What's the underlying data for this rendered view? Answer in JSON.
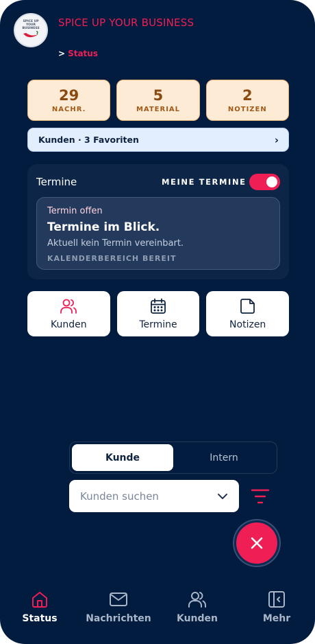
{
  "header": {
    "logo_text": "SPICE UP YOUR BUSINESS",
    "app_title": "SPICE UP YOUR BUSINESS",
    "breadcrumb_separator": ">",
    "breadcrumb_current": "Status"
  },
  "stats": [
    {
      "value": "29",
      "label": "NACHR."
    },
    {
      "value": "5",
      "label": "MATERIAL"
    },
    {
      "value": "2",
      "label": "NOTIZEN"
    }
  ],
  "favorites_bar": {
    "label": "Kunden · 3 Favoriten",
    "chevron": "›"
  },
  "termine_panel": {
    "title": "Termine",
    "toggle_label": "MEINE TERMINE",
    "toggle_on": true,
    "card": {
      "status": "Termin offen",
      "heading": "Termine im Blick.",
      "description": "Aktuell kein Termin vereinbart.",
      "footer": "KALENDERBEREICH BEREIT"
    }
  },
  "quick_actions": [
    {
      "label": "Kunden",
      "icon": "users-icon"
    },
    {
      "label": "Termine",
      "icon": "calendar-icon"
    },
    {
      "label": "Notizen",
      "icon": "note-icon"
    }
  ],
  "segmented": {
    "options": [
      "Kunde",
      "Intern"
    ],
    "selected": "Kunde"
  },
  "search": {
    "placeholder": "Kunden suchen"
  },
  "bottom_nav": [
    {
      "label": "Status",
      "icon": "home-icon",
      "active": true
    },
    {
      "label": "Nachrichten",
      "icon": "mail-icon",
      "active": false
    },
    {
      "label": "Kunden",
      "icon": "users-icon",
      "active": false
    },
    {
      "label": "Mehr",
      "icon": "sidebar-icon",
      "active": false
    }
  ],
  "colors": {
    "background": "#021c3f",
    "accent": "#ef1f56",
    "stat_bg": "#fdebd6",
    "stat_text": "#8a4b12"
  }
}
